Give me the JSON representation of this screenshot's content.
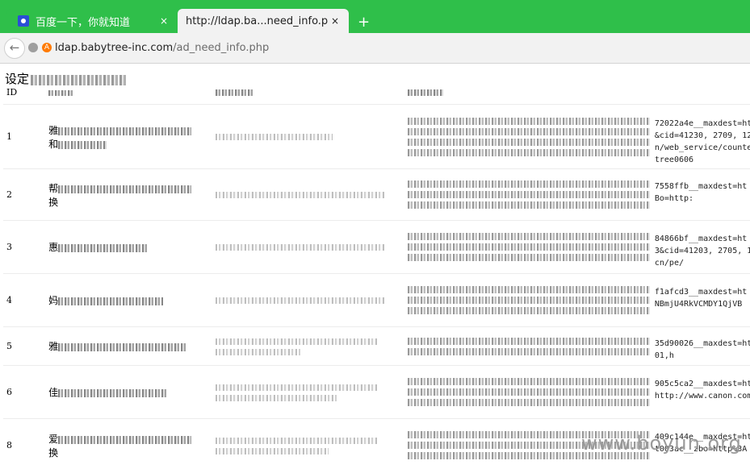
{
  "browser": {
    "tabs": [
      {
        "title": "百度一下，你就知道",
        "active": false,
        "close": "×"
      },
      {
        "title": "http://ldap.ba...need_info.php",
        "active": true,
        "close": "×"
      }
    ],
    "new_tab": "+",
    "back": "←",
    "url_host": "ldap.babytree-inc.com",
    "url_path": "/ad_need_info.php",
    "theme_color": "#2fbf4a"
  },
  "page": {
    "heading": "设定",
    "columns": [
      "ID",
      "",
      "",
      ""
    ],
    "rows": [
      {
        "id": "1",
        "name_a": "雅",
        "name_b": "和",
        "tail": [
          "72022a4e__maxdest=ht",
          "&cid=41230, 2709, 127&",
          "n/web_service/counte",
          "tree0606"
        ]
      },
      {
        "id": "2",
        "name_a": "帮",
        "name_b": "换",
        "tail": [
          "7558ffb__maxdest=ht",
          "Bo=http:",
          ""
        ]
      },
      {
        "id": "3",
        "name_a": "惠",
        "name_b": "",
        "tail": [
          "84866bf__maxdest=ht",
          "3&cid=41203, 2705, 127",
          "cn/pe/"
        ]
      },
      {
        "id": "4",
        "name_a": "妈",
        "name_b": "",
        "tail": [
          "f1afcd3__maxdest=ht",
          "NBmjU4RkVCMDY1QjVB",
          ""
        ]
      },
      {
        "id": "5",
        "name_a": "雅",
        "name_b": "",
        "tail": [
          "35d90026__maxdest=ht",
          "01,h"
        ]
      },
      {
        "id": "6",
        "name_a": "佳",
        "name_b": "",
        "tail": [
          "905c5ca2__maxdest=ht",
          "http://www.canon.com",
          ""
        ]
      },
      {
        "id": "8",
        "name_a": "爱",
        "name_b": "换",
        "tail": [
          "409c144e__maxdest=ht",
          "t003ac__zbo=http%3A",
          ""
        ]
      }
    ]
  },
  "watermark": "www.boyun.org"
}
